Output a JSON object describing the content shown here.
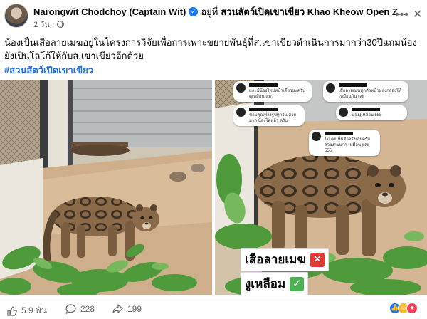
{
  "header": {
    "author": "Narongwit Chodchoy (Captain Wit)",
    "at_word": "อยู่ที่",
    "page_name": "สวนสัตว์เปิดเขาเขียว Khao Kheow Open Z...",
    "time": "2 วัน",
    "separator": "·",
    "visibility_icon": "globe-icon",
    "more_icon": "more-icon",
    "close_icon": "close-icon"
  },
  "post": {
    "text": "น้องเป็นเสือลายเมฆอยู่ในโครงการวิจัยเพื่อการเพาะขยายพันธุ์ที่ส.เขาเขียวดำเนินการมากว่า30ปีแถมน้องยังเป็นโลโก้ให้กับส.เขาเขียวอีกด้วย",
    "hashtag": "#สวนสัตว์เปิดเขาเขียว"
  },
  "photo_right": {
    "comments": [
      {
        "text": "และมีน้องใหม่หน้าเดียวนะครับ ดูเหมือน แมว"
      },
      {
        "text": "เสือลายเมฆทุกตัวหน้ามองกล่องให้เหมือนกัน เลย"
      },
      {
        "text": "ขอบคุณที่ลงรูปทุกวัน สวยมาก น้องโตแล้ว ครับ"
      },
      {
        "text": "น้องงูเหลือม 555"
      },
      {
        "text": "ไม่เคยเห็นตัวจริงเลยครับ สวยงามมาก เหมือนงูเลย 555"
      }
    ],
    "caption_wrong": "เสือลายเมฆ",
    "caption_right": "งูเหลือม",
    "wrong_icon": "cross-mark-icon",
    "right_icon": "check-mark-icon"
  },
  "footer": {
    "likes": "5.9 พัน",
    "comments": "228",
    "shares": "199",
    "reaction_icons": [
      "like-icon",
      "haha-icon",
      "love-icon"
    ]
  },
  "colors": {
    "link": "#216fdb",
    "verified": "#1877f2",
    "muted": "#65676b"
  }
}
